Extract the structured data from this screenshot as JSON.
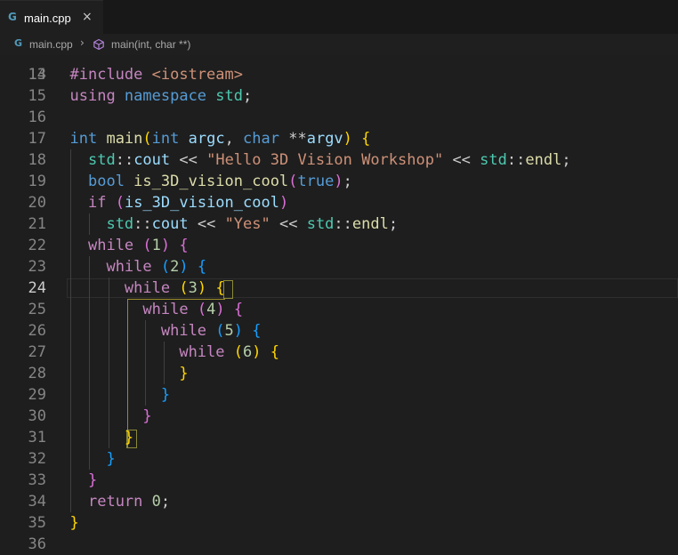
{
  "tab": {
    "icon": "G",
    "label": "main.cpp",
    "close": "×"
  },
  "breadcrumb": {
    "file_icon": "G",
    "file": "main.cpp",
    "separator": "›",
    "symbol": "main(int, char **)"
  },
  "editor": {
    "partial_line_number": "13",
    "lines": [
      {
        "n": "14",
        "tokens": [
          {
            "t": "#include ",
            "c": "kw"
          },
          {
            "t": "<iostream>",
            "c": "str"
          }
        ]
      },
      {
        "n": "15",
        "tokens": [
          {
            "t": "using ",
            "c": "kw"
          },
          {
            "t": "namespace ",
            "c": "ty"
          },
          {
            "t": "std",
            "c": "ns"
          },
          {
            "t": ";",
            "c": ""
          }
        ]
      },
      {
        "n": "16",
        "tokens": []
      },
      {
        "n": "17",
        "tokens": [
          {
            "t": "int ",
            "c": "ty"
          },
          {
            "t": "main",
            "c": "fn"
          },
          {
            "t": "(",
            "c": "b1"
          },
          {
            "t": "int ",
            "c": "ty"
          },
          {
            "t": "argc",
            "c": "var"
          },
          {
            "t": ", ",
            "c": ""
          },
          {
            "t": "char ",
            "c": "ty"
          },
          {
            "t": "**",
            "c": ""
          },
          {
            "t": "argv",
            "c": "var"
          },
          {
            "t": ")",
            "c": "b1"
          },
          {
            "t": " ",
            "c": ""
          },
          {
            "t": "{",
            "c": "b1"
          }
        ]
      },
      {
        "n": "18",
        "tokens": [
          {
            "t": "  ",
            "c": ""
          },
          {
            "t": "std",
            "c": "ns"
          },
          {
            "t": "::",
            "c": ""
          },
          {
            "t": "cout",
            "c": "var"
          },
          {
            "t": " << ",
            "c": ""
          },
          {
            "t": "\"Hello 3D Vision Workshop\"",
            "c": "str"
          },
          {
            "t": " << ",
            "c": ""
          },
          {
            "t": "std",
            "c": "ns"
          },
          {
            "t": "::",
            "c": ""
          },
          {
            "t": "endl",
            "c": "fn"
          },
          {
            "t": ";",
            "c": ""
          }
        ]
      },
      {
        "n": "19",
        "tokens": [
          {
            "t": "  ",
            "c": ""
          },
          {
            "t": "bool ",
            "c": "ty"
          },
          {
            "t": "is_3D_vision_cool",
            "c": "fn"
          },
          {
            "t": "(",
            "c": "b2"
          },
          {
            "t": "true",
            "c": "ty"
          },
          {
            "t": ")",
            "c": "b2"
          },
          {
            "t": ";",
            "c": ""
          }
        ]
      },
      {
        "n": "20",
        "tokens": [
          {
            "t": "  ",
            "c": ""
          },
          {
            "t": "if ",
            "c": "kw"
          },
          {
            "t": "(",
            "c": "b2"
          },
          {
            "t": "is_3D_vision_cool",
            "c": "var"
          },
          {
            "t": ")",
            "c": "b2"
          }
        ]
      },
      {
        "n": "21",
        "tokens": [
          {
            "t": "    ",
            "c": ""
          },
          {
            "t": "std",
            "c": "ns"
          },
          {
            "t": "::",
            "c": ""
          },
          {
            "t": "cout",
            "c": "var"
          },
          {
            "t": " << ",
            "c": ""
          },
          {
            "t": "\"Yes\"",
            "c": "str"
          },
          {
            "t": " << ",
            "c": ""
          },
          {
            "t": "std",
            "c": "ns"
          },
          {
            "t": "::",
            "c": ""
          },
          {
            "t": "endl",
            "c": "fn"
          },
          {
            "t": ";",
            "c": ""
          }
        ]
      },
      {
        "n": "22",
        "tokens": [
          {
            "t": "  ",
            "c": ""
          },
          {
            "t": "while ",
            "c": "kw"
          },
          {
            "t": "(",
            "c": "b2"
          },
          {
            "t": "1",
            "c": "num"
          },
          {
            "t": ")",
            "c": "b2"
          },
          {
            "t": " ",
            "c": ""
          },
          {
            "t": "{",
            "c": "b2"
          }
        ]
      },
      {
        "n": "23",
        "tokens": [
          {
            "t": "    ",
            "c": ""
          },
          {
            "t": "while ",
            "c": "kw"
          },
          {
            "t": "(",
            "c": "b3"
          },
          {
            "t": "2",
            "c": "num"
          },
          {
            "t": ")",
            "c": "b3"
          },
          {
            "t": " ",
            "c": ""
          },
          {
            "t": "{",
            "c": "b3"
          }
        ]
      },
      {
        "n": "24",
        "tokens": [
          {
            "t": "      ",
            "c": ""
          },
          {
            "t": "while ",
            "c": "kw"
          },
          {
            "t": "(",
            "c": "b1"
          },
          {
            "t": "3",
            "c": "num"
          },
          {
            "t": ")",
            "c": "b1"
          },
          {
            "t": " ",
            "c": ""
          },
          {
            "t": "{",
            "c": "b1"
          }
        ]
      },
      {
        "n": "25",
        "tokens": [
          {
            "t": "        ",
            "c": ""
          },
          {
            "t": "while ",
            "c": "kw"
          },
          {
            "t": "(",
            "c": "b2"
          },
          {
            "t": "4",
            "c": "num"
          },
          {
            "t": ")",
            "c": "b2"
          },
          {
            "t": " ",
            "c": ""
          },
          {
            "t": "{",
            "c": "b2"
          }
        ]
      },
      {
        "n": "26",
        "tokens": [
          {
            "t": "          ",
            "c": ""
          },
          {
            "t": "while ",
            "c": "kw"
          },
          {
            "t": "(",
            "c": "b3"
          },
          {
            "t": "5",
            "c": "num"
          },
          {
            "t": ")",
            "c": "b3"
          },
          {
            "t": " ",
            "c": ""
          },
          {
            "t": "{",
            "c": "b3"
          }
        ]
      },
      {
        "n": "27",
        "tokens": [
          {
            "t": "            ",
            "c": ""
          },
          {
            "t": "while ",
            "c": "kw"
          },
          {
            "t": "(",
            "c": "b1"
          },
          {
            "t": "6",
            "c": "num"
          },
          {
            "t": ")",
            "c": "b1"
          },
          {
            "t": " ",
            "c": ""
          },
          {
            "t": "{",
            "c": "b1"
          }
        ]
      },
      {
        "n": "28",
        "tokens": [
          {
            "t": "            ",
            "c": ""
          },
          {
            "t": "}",
            "c": "b1"
          }
        ]
      },
      {
        "n": "29",
        "tokens": [
          {
            "t": "          ",
            "c": ""
          },
          {
            "t": "}",
            "c": "b3"
          }
        ]
      },
      {
        "n": "30",
        "tokens": [
          {
            "t": "        ",
            "c": ""
          },
          {
            "t": "}",
            "c": "b2"
          }
        ]
      },
      {
        "n": "31",
        "tokens": [
          {
            "t": "      ",
            "c": ""
          },
          {
            "t": "}",
            "c": "b1"
          }
        ]
      },
      {
        "n": "32",
        "tokens": [
          {
            "t": "    ",
            "c": ""
          },
          {
            "t": "}",
            "c": "b3"
          }
        ]
      },
      {
        "n": "33",
        "tokens": [
          {
            "t": "  ",
            "c": ""
          },
          {
            "t": "}",
            "c": "b2"
          }
        ]
      },
      {
        "n": "34",
        "tokens": [
          {
            "t": "  ",
            "c": ""
          },
          {
            "t": "return ",
            "c": "kw"
          },
          {
            "t": "0",
            "c": "num"
          },
          {
            "t": ";",
            "c": ""
          }
        ]
      },
      {
        "n": "35",
        "tokens": [
          {
            "t": "}",
            "c": "b1"
          }
        ]
      },
      {
        "n": "36",
        "tokens": []
      }
    ]
  }
}
